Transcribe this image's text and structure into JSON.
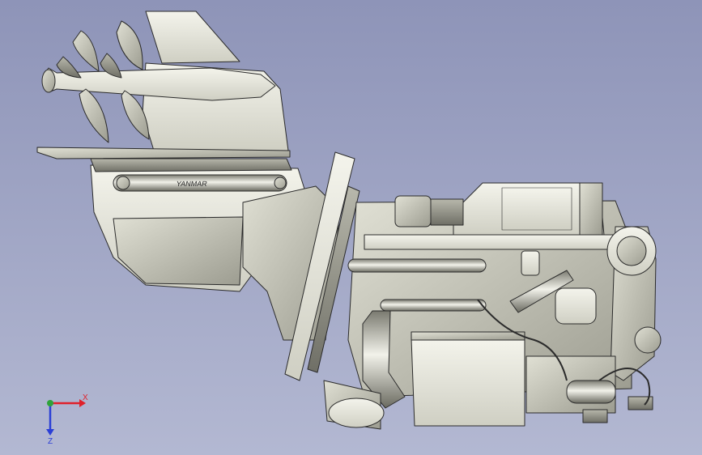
{
  "colors": {
    "background_top": "#8e94b8",
    "background_bottom": "#b3b8d2",
    "part_light": "#ecece2",
    "part_mid": "#c9c9bd",
    "part_shade": "#9c9c90",
    "edge": "#2b2b2b",
    "axis_x": "#e0202a",
    "axis_y": "#2ea33a",
    "axis_z": "#2b3fd6"
  },
  "model": {
    "name": "sterndrive-engine-assembly-icon",
    "emblem_text": "YANMAR"
  },
  "triad": {
    "x_label": "X",
    "z_label": "Z"
  }
}
